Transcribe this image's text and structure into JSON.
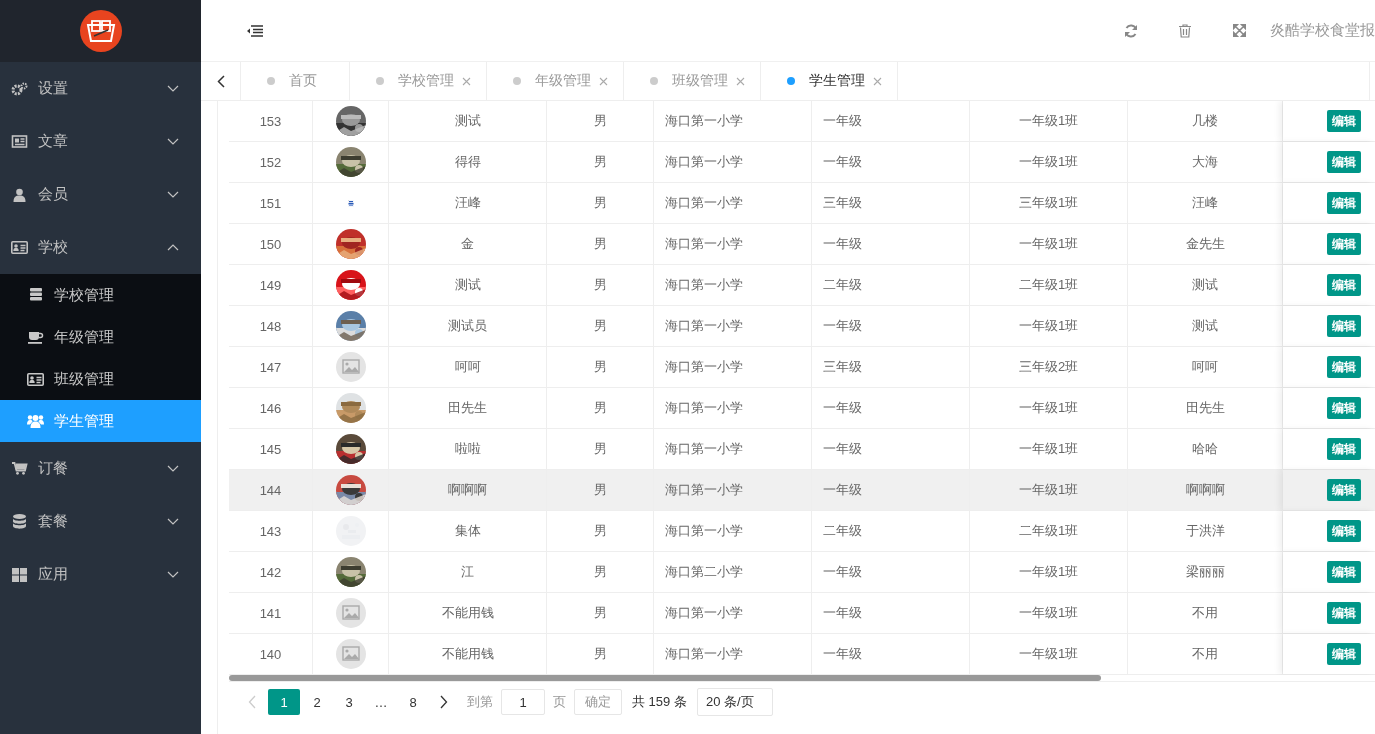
{
  "header": {
    "title": "炎酷学校食堂报"
  },
  "sidebar": {
    "items": [
      {
        "label": "设置",
        "expanded": false
      },
      {
        "label": "文章",
        "expanded": false
      },
      {
        "label": "会员",
        "expanded": false
      },
      {
        "label": "学校",
        "expanded": true,
        "children": [
          {
            "label": "学校管理",
            "selected": false
          },
          {
            "label": "年级管理",
            "selected": false
          },
          {
            "label": "班级管理",
            "selected": false
          },
          {
            "label": "学生管理",
            "selected": true
          }
        ]
      },
      {
        "label": "订餐",
        "expanded": false
      },
      {
        "label": "套餐",
        "expanded": false
      },
      {
        "label": "应用",
        "expanded": false
      }
    ]
  },
  "tabs": [
    {
      "label": "首页",
      "closable": false,
      "selected": false
    },
    {
      "label": "学校管理",
      "closable": true,
      "selected": false
    },
    {
      "label": "年级管理",
      "closable": true,
      "selected": false
    },
    {
      "label": "班级管理",
      "closable": true,
      "selected": false
    },
    {
      "label": "学生管理",
      "closable": true,
      "selected": true
    }
  ],
  "table": {
    "rows": [
      {
        "id": "153",
        "name": "测试",
        "gender": "男",
        "school": "海口第一小学",
        "grade": "一年级",
        "class": "一年级1班",
        "parent": "几楼",
        "action": "编辑",
        "hovered": false
      },
      {
        "id": "152",
        "name": "得得",
        "gender": "男",
        "school": "海口第一小学",
        "grade": "一年级",
        "class": "一年级1班",
        "parent": "大海",
        "action": "编辑",
        "hovered": false
      },
      {
        "id": "151",
        "avatar": {
          "kind": "tiny"
        },
        "name": "汪峰",
        "gender": "男",
        "school": "海口第一小学",
        "grade": "三年级",
        "class": "三年级1班",
        "parent": "汪峰",
        "action": "编辑",
        "hovered": false
      },
      {
        "id": "150",
        "name": "金",
        "gender": "男",
        "school": "海口第一小学",
        "grade": "一年级",
        "class": "一年级1班",
        "parent": "金先生",
        "action": "编辑",
        "hovered": false
      },
      {
        "id": "149",
        "name": "测试",
        "gender": "男",
        "school": "海口第一小学",
        "grade": "二年级",
        "class": "二年级1班",
        "parent": "测试",
        "action": "编辑",
        "hovered": false
      },
      {
        "id": "148",
        "name": "测试员",
        "gender": "男",
        "school": "海口第一小学",
        "grade": "一年级",
        "class": "一年级1班",
        "parent": "测试",
        "action": "编辑",
        "hovered": false
      },
      {
        "id": "147",
        "avatar": {
          "kind": "placeholder"
        },
        "name": "呵呵",
        "gender": "男",
        "school": "海口第一小学",
        "grade": "三年级",
        "class": "三年级2班",
        "parent": "呵呵",
        "action": "编辑",
        "hovered": false
      },
      {
        "id": "146",
        "name": "田先生",
        "gender": "男",
        "school": "海口第一小学",
        "grade": "一年级",
        "class": "一年级1班",
        "parent": "田先生",
        "action": "编辑",
        "hovered": false
      },
      {
        "id": "145",
        "name": "啦啦",
        "gender": "男",
        "school": "海口第一小学",
        "grade": "一年级",
        "class": "一年级1班",
        "parent": "哈哈",
        "action": "编辑",
        "hovered": false
      },
      {
        "id": "144",
        "name": "啊啊啊",
        "gender": "男",
        "school": "海口第一小学",
        "grade": "一年级",
        "class": "一年级1班",
        "parent": "啊啊啊",
        "action": "编辑",
        "hovered": true
      },
      {
        "id": "143",
        "avatar": {
          "kind": "blank"
        },
        "name": "集体",
        "gender": "男",
        "school": "海口第一小学",
        "grade": "二年级",
        "class": "二年级1班",
        "parent": "于洪洋",
        "action": "编辑",
        "hovered": false
      },
      {
        "id": "142",
        "name": "江",
        "gender": "男",
        "school": "海口第二小学",
        "grade": "一年级",
        "class": "一年级1班",
        "parent": "梁丽丽",
        "action": "编辑",
        "hovered": false
      },
      {
        "id": "141",
        "avatar": {
          "kind": "placeholder"
        },
        "name": "不能用钱",
        "gender": "男",
        "school": "海口第一小学",
        "grade": "一年级",
        "class": "一年级1班",
        "parent": "不用",
        "action": "编辑",
        "hovered": false
      },
      {
        "id": "140",
        "avatar": {
          "kind": "placeholder"
        },
        "name": "不能用钱",
        "gender": "男",
        "school": "海口第一小学",
        "grade": "一年级",
        "class": "一年级1班",
        "parent": "不用",
        "action": "编辑",
        "hovered": false
      }
    ]
  },
  "pagination": {
    "pages": [
      {
        "label": "1",
        "selected": true
      },
      {
        "label": "2",
        "selected": false
      },
      {
        "label": "3",
        "selected": false
      },
      {
        "label": "…",
        "selected": false
      },
      {
        "label": "8",
        "selected": false
      }
    ],
    "prev_disabled": true,
    "goto_label": "到第",
    "goto_value": "1",
    "page_unit": "页",
    "confirm": "确定",
    "total": "共 159 条",
    "page_size": "20 条/页"
  }
}
